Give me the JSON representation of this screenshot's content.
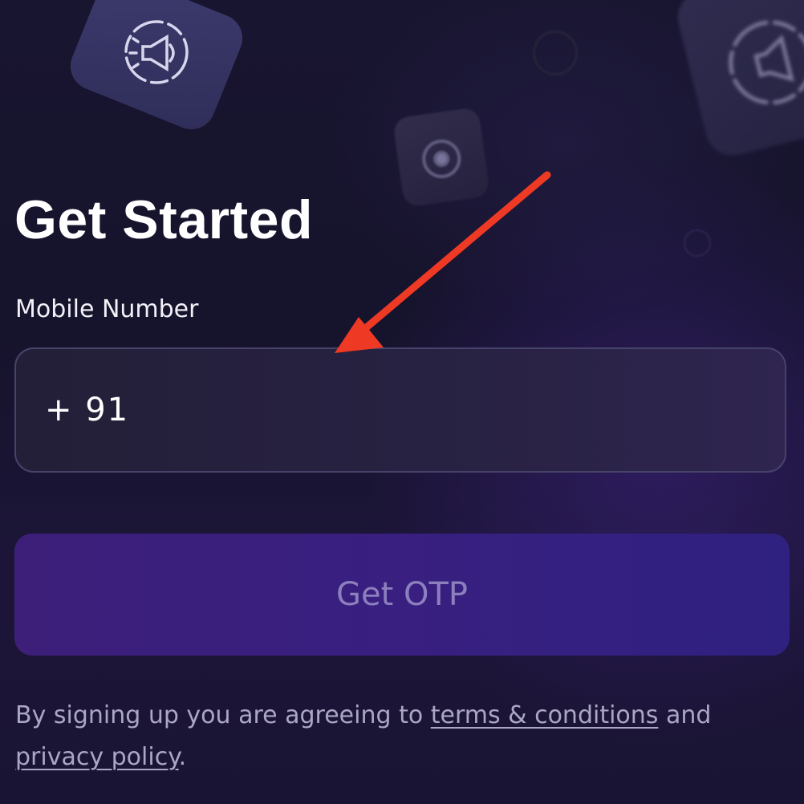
{
  "title": "Get Started",
  "phone": {
    "label": "Mobile Number",
    "country_code": "+ 91",
    "value": ""
  },
  "otp_button": {
    "label": "Get OTP",
    "enabled": false
  },
  "agreement": {
    "prefix": "By signing up you are agreeing to ",
    "terms_link": "terms & conditions",
    "joiner": " and ",
    "privacy_link": "privacy policy",
    "suffix": "."
  },
  "decorations": {
    "icons": [
      "megaphone-icon",
      "camera-icon",
      "megaphone-icon"
    ]
  },
  "colors": {
    "background": "#17142e",
    "button": "#381f80",
    "button_text": "#8c7fbe",
    "field_border": "#46436a",
    "annotation_arrow": "#ee3a24"
  }
}
